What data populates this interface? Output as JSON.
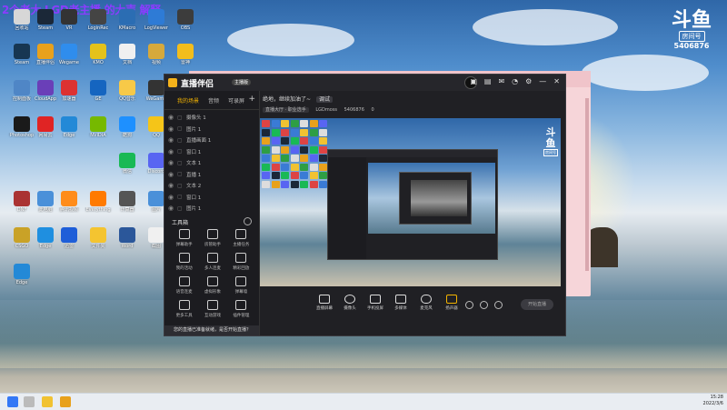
{
  "headline": "2个老大 LGD老主播 的大声 解释",
  "watermark": {
    "logo": "斗鱼",
    "room_label": "房间号",
    "room_id": "5406876"
  },
  "desktop_icons": [
    {
      "label": "回收站",
      "color": "#d7d7d7"
    },
    {
      "label": "Steam",
      "color": "#1b2838"
    },
    {
      "label": "VR",
      "color": "#333"
    },
    {
      "label": "LoginRec",
      "color": "#444"
    },
    {
      "label": "KMacro",
      "color": "#2b6db3"
    },
    {
      "label": "LogViewer",
      "color": "#2e7bd6"
    },
    {
      "label": "OBS",
      "color": "#3c3c3c"
    },
    {
      "label": "Steam",
      "color": "#173652"
    },
    {
      "label": "直播伴侣",
      "color": "#e8a11c"
    },
    {
      "label": "Wegame",
      "color": "#2f8ded"
    },
    {
      "label": "KMO",
      "color": "#e4c21b"
    },
    {
      "label": "文档",
      "color": "#f0f0f0"
    },
    {
      "label": "视频",
      "color": "#d6a93c"
    },
    {
      "label": "雷神",
      "color": "#f2bd1c"
    },
    {
      "label": "控制面板",
      "color": "#4f86c6"
    },
    {
      "label": "CloudApp",
      "color": "#6a3fb8"
    },
    {
      "label": "加速器",
      "color": "#dc3232"
    },
    {
      "label": "GE",
      "color": "#1565c0"
    },
    {
      "label": "QQ音乐",
      "color": "#f7c948"
    },
    {
      "label": "WeGame",
      "color": "#333"
    },
    {
      "label": "Tencent",
      "color": "#1aa6ff"
    },
    {
      "label": "Photoshop",
      "color": "#1a1a1a"
    },
    {
      "label": "网易云",
      "color": "#e02424"
    },
    {
      "label": "Edge",
      "color": "#2389d7"
    },
    {
      "label": "NVIDIA",
      "color": "#76b900"
    },
    {
      "label": "酷狗",
      "color": "#1e90ff"
    },
    {
      "label": "QQ",
      "color": "#f5c518"
    },
    {
      "label": "Chrome",
      "color": "#2e9e44"
    },
    {
      "label": "微信",
      "color": "#19b955"
    },
    {
      "label": "Discord",
      "color": "#5865f2"
    },
    {
      "label": "DNF",
      "color": "#a33"
    },
    {
      "label": "此电脑",
      "color": "#4a90d9"
    },
    {
      "label": "腾讯视频",
      "color": "#ff8c1a"
    },
    {
      "label": "Everything",
      "color": "#ff7a00"
    },
    {
      "label": "计算器",
      "color": "#555"
    },
    {
      "label": "图片",
      "color": "#4a90d9"
    },
    {
      "label": "CSGO",
      "color": "#c9a227"
    },
    {
      "label": "Edge",
      "color": "#1f8fe0"
    },
    {
      "label": "迅雷",
      "color": "#1e5ed8"
    },
    {
      "label": "文件夹",
      "color": "#f4c430"
    },
    {
      "label": "Word",
      "color": "#2b579a"
    },
    {
      "label": "截图",
      "color": "#f0f0f0"
    },
    {
      "label": "Edge",
      "color": "#2389d7"
    }
  ],
  "app": {
    "name": "直播伴侣",
    "version": "主播版",
    "tabs": [
      "我的场景",
      "音频",
      "可录屏"
    ],
    "sources": [
      {
        "label": "摄像头 1"
      },
      {
        "label": "图片 1"
      },
      {
        "label": "直播画面 1"
      },
      {
        "label": "窗口 1"
      },
      {
        "label": "文本 1"
      },
      {
        "label": "直播 1"
      },
      {
        "label": "文本 2"
      },
      {
        "label": "窗口 1"
      },
      {
        "label": "图片 1"
      }
    ],
    "tools_header": "工具箱",
    "tools": [
      "弹幕助手",
      "房管助手",
      "主播任务",
      "我的活动",
      "多人连麦",
      "精彩回放",
      "语音连麦",
      "虚拟形象",
      "弹幕墙",
      "更多工具",
      "互动游戏",
      "插件管理"
    ],
    "notice": "您的直播已准备就绪，是否开始直播？",
    "stream_title": "绝地，继续加油了~",
    "badge": "调试",
    "info_chips": [
      "直播大厅 · 职业选手",
      "LGDmoss",
      "5406876",
      "0"
    ],
    "preview_logo": "斗鱼",
    "preview_room": "房间号",
    "bottom_buttons": [
      "直播屏幕",
      "摄像头",
      "手机投屏",
      "多媒体",
      "麦克风",
      "扬声器"
    ],
    "start_button": "开始直播"
  },
  "tray": {
    "time": "15:28",
    "date": "2022/3/6"
  }
}
